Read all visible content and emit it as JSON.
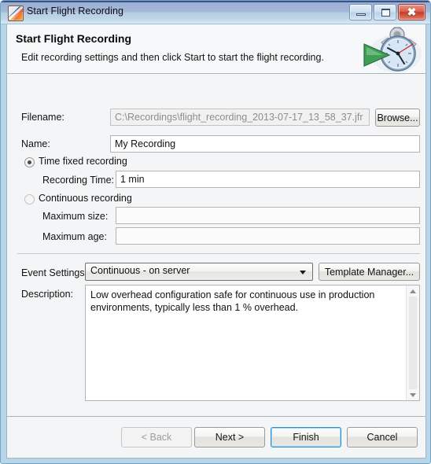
{
  "window": {
    "title": "Start Flight Recording",
    "icon": "flight-recorder-icon",
    "controls": {
      "minimize": "minimize-icon",
      "maximize": "maximize-icon",
      "close_glyph": "✖"
    }
  },
  "header": {
    "title": "Start Flight Recording",
    "subtitle": "Edit recording settings and then click Start to start the flight recording.",
    "graphic": "stopwatch-play-icon"
  },
  "form": {
    "filename_label": "Filename:",
    "filename_value": "C:\\Recordings\\flight_recording_2013-07-17_13_58_37.jfr",
    "browse_label": "Browse...",
    "name_label": "Name:",
    "name_value": "My Recording",
    "time_fixed_label": "Time fixed recording",
    "time_fixed_selected": true,
    "recording_time_label": "Recording Time:",
    "recording_time_value": "1 min",
    "continuous_label": "Continuous recording",
    "continuous_selected": false,
    "max_size_label": "Maximum size:",
    "max_size_value": "",
    "max_age_label": "Maximum age:",
    "max_age_value": ""
  },
  "event_settings": {
    "label": "Event Settings:",
    "selected": "Continuous - on server",
    "options": [
      "Continuous - on server"
    ],
    "template_manager_label": "Template Manager..."
  },
  "description": {
    "label": "Description:",
    "text": "Low overhead configuration safe for continuous use in production environments, typically less than 1 % overhead."
  },
  "footer": {
    "back_label": "< Back",
    "back_disabled": true,
    "next_label": "Next >",
    "finish_label": "Finish",
    "finish_default": true,
    "cancel_label": "Cancel"
  },
  "colors": {
    "frame": "#b8d6e8",
    "titlebar_top": "#8fa8cf",
    "client_bg": "#f4f5f6",
    "focus_ring": "#2a8fd0",
    "close_button": "#c33c27"
  }
}
